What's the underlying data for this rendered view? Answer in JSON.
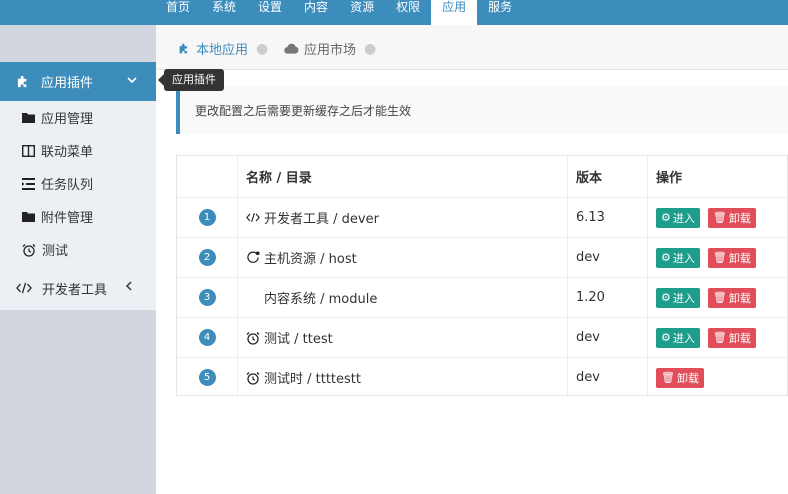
{
  "topnav": {
    "items": [
      {
        "label": "首页"
      },
      {
        "label": "系统"
      },
      {
        "label": "设置"
      },
      {
        "label": "内容"
      },
      {
        "label": "资源"
      },
      {
        "label": "权限"
      },
      {
        "label": "应用"
      },
      {
        "label": "服务"
      }
    ],
    "active": "应用"
  },
  "sidebar": {
    "section": {
      "label": "应用插件",
      "icon": "puzzle-icon"
    },
    "items": [
      {
        "label": "应用管理",
        "icon": "folder-icon"
      },
      {
        "label": "联动菜单",
        "icon": "columns-icon"
      },
      {
        "label": "任务队列",
        "icon": "list-icon"
      },
      {
        "label": "附件管理",
        "icon": "folder-icon"
      },
      {
        "label": "测试",
        "icon": "alarm-clock-icon"
      }
    ],
    "developer": {
      "label": "开发者工具",
      "icon": "code-icon"
    }
  },
  "tooltip": {
    "text": "应用插件"
  },
  "tabs": [
    {
      "label": "本地应用",
      "icon": "puzzle-icon"
    },
    {
      "label": "应用市场",
      "icon": "cloud-icon"
    }
  ],
  "notice": {
    "text": "更改配置之后需要更新缓存之后才能生效"
  },
  "table": {
    "headers": {
      "name": "名称 / 目录",
      "version": "版本",
      "actions": "操作"
    },
    "rows": [
      {
        "num": "1",
        "name": "开发者工具 / dever",
        "icon": "code-icon",
        "version": "6.13",
        "enter": "进入",
        "uninstall": "卸载"
      },
      {
        "num": "2",
        "name": "主机资源 / host",
        "icon": "host-icon",
        "version": "dev",
        "enter": "进入",
        "uninstall": "卸载"
      },
      {
        "num": "3",
        "name": "内容系统 / module",
        "icon": "",
        "version": "1.20",
        "enter": "进入",
        "uninstall": "卸载"
      },
      {
        "num": "4",
        "name": "测试 / ttest",
        "icon": "alarm-clock-icon",
        "version": "dev",
        "enter": "进入",
        "uninstall": "卸载"
      },
      {
        "num": "5",
        "name": "测试时 / ttttestt",
        "icon": "alarm-clock-icon",
        "version": "dev",
        "enter": "",
        "uninstall": "卸载"
      }
    ]
  },
  "colors": {
    "primary": "#3c8dbc",
    "sidebar_bg": "#d2d6de",
    "enter_btn": "#1d9e8c",
    "delete_btn": "#e24d5a"
  }
}
